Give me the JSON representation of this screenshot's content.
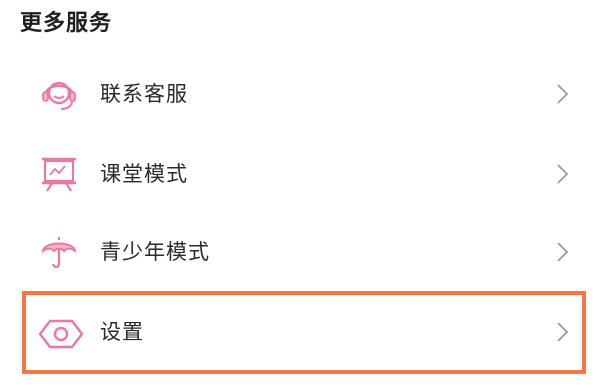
{
  "section": {
    "title": "更多服务"
  },
  "items": [
    {
      "label": "联系客服",
      "icon": "customer-service-headset-icon"
    },
    {
      "label": "课堂模式",
      "icon": "presentation-board-icon"
    },
    {
      "label": "青少年模式",
      "icon": "umbrella-icon"
    },
    {
      "label": "设置",
      "icon": "settings-hexagon-icon"
    }
  ],
  "colors": {
    "icon_accent": "#e87aa2",
    "highlight_border": "#f07a47",
    "chevron": "#9a9a9a"
  }
}
